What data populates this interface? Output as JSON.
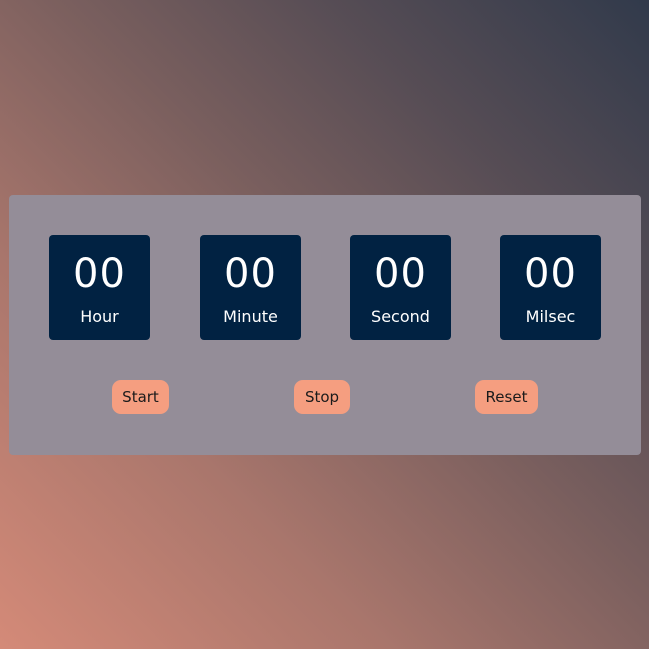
{
  "stopwatch": {
    "units": [
      {
        "value": "00",
        "label": "Hour"
      },
      {
        "value": "00",
        "label": "Minute"
      },
      {
        "value": "00",
        "label": "Second"
      },
      {
        "value": "00",
        "label": "Milsec"
      }
    ],
    "buttons": {
      "start": "Start",
      "stop": "Stop",
      "reset": "Reset"
    }
  },
  "colors": {
    "panel": "#948d98",
    "display_box": "#012242",
    "button": "#f59e80",
    "bg_gradient_start": "#d48a78",
    "bg_gradient_end": "#313a4b"
  }
}
